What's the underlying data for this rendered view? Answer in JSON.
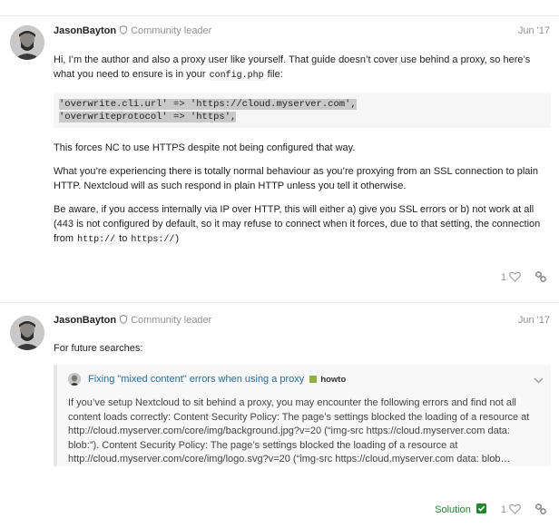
{
  "posts": [
    {
      "author": "JasonBayton",
      "role": "Community leader",
      "date": "Jun '17",
      "p1_pre": "Hi, I’m the author and also a proxy user like yourself. That guide doesn’t cover use behind a proxy, so here’s what you need to ensure is in your ",
      "p1_code": "config.php",
      "p1_post": " file:",
      "code_lines": [
        "'overwrite.cli.url' => 'https://cloud.myserver.com',",
        "'overwriteprotocol' => 'https',"
      ],
      "p2": "This forces NC to use HTTPS despite not being configured that way.",
      "p3": "What you’re experiencing there is totally normal behaviour as you’re proxying from an SSL connection to plain HTTP. Nextcloud will as such respond in plain HTTP unless you tell it otherwise.",
      "p4_pre": "Be aware, if you access internally via IP over HTTP, this will either a) give you SSL errors or b) not work at all (443 is not configured by default, so it may refuse to connect when it forces, due to that setting, the connection from ",
      "p4_code1": "http://",
      "p4_mid": " to ",
      "p4_code2": "https://",
      "p4_post": ")",
      "likes": "1"
    },
    {
      "author": "JasonBayton",
      "role": "Community leader",
      "date": "Jun '17",
      "p1": "For future searches:",
      "quote": {
        "title": "Fixing \"mixed content\" errors when using a proxy",
        "category": "howto",
        "category_color": "#8fb23d",
        "text": "If you’ve setup Nextcloud to sit behind a proxy, you may encounter the following errors and find not all content loads correctly: Content Security Policy: The page’s settings blocked the loading of a resource at http://cloud.myserver.com/core/img/background.jpg?v=20 (“img-src https://cloud.myserver.com data: blob:”). Content Security Policy: The page’s settings blocked the loading of a resource at http://cloud.myserver.com/core/img/logo.svg?v=20 (“img-src https://cloud.myserver.com data: blob…"
      },
      "solution_label": "Solution",
      "likes": "1"
    }
  ],
  "icons": {
    "shield": "shield-icon",
    "heart": "heart-icon",
    "link": "link-icon",
    "check": "check-icon",
    "chevron": "chevron-down-icon"
  },
  "colors": {
    "link": "#1d6ca8",
    "solution": "#1f8a2a",
    "muted": "#919191"
  }
}
